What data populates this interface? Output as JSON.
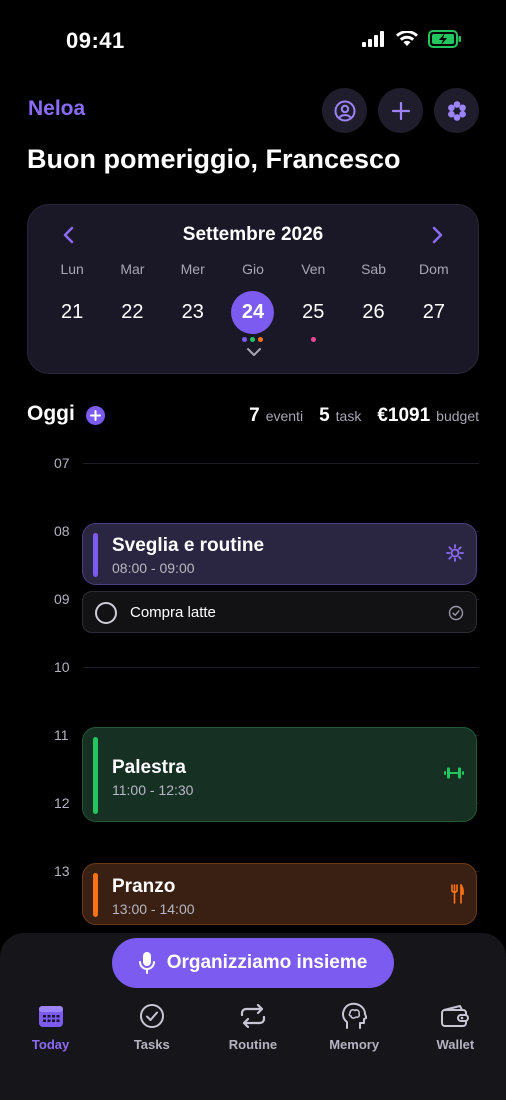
{
  "status": {
    "time": "09:41"
  },
  "header": {
    "brand": "Neloa",
    "greeting": "Buon pomeriggio, Francesco",
    "actions": [
      "profile-icon",
      "plus-icon",
      "apps-icon"
    ]
  },
  "calendar": {
    "month": "Settembre 2026",
    "days": [
      {
        "name": "Lun",
        "num": "21"
      },
      {
        "name": "Mar",
        "num": "22"
      },
      {
        "name": "Mer",
        "num": "23"
      },
      {
        "name": "Gio",
        "num": "24",
        "selected": true
      },
      {
        "name": "Ven",
        "num": "25"
      },
      {
        "name": "Sab",
        "num": "26"
      },
      {
        "name": "Dom",
        "num": "27"
      }
    ],
    "dot_colors": {
      "gio": [
        "#7c5cf0",
        "#22c55e",
        "#f97316"
      ],
      "ven": [
        "#ec4899"
      ]
    }
  },
  "today": {
    "title": "Oggi",
    "events_count": "7",
    "events_label": "eventi",
    "tasks_count": "5",
    "tasks_label": "task",
    "budget_value": "€1091",
    "budget_label": "budget"
  },
  "timeline": {
    "hours": [
      "07",
      "08",
      "09",
      "10",
      "11",
      "12",
      "13"
    ],
    "events": [
      {
        "title": "Sveglia e routine",
        "time": "08:00 - 09:00",
        "color": "#7c5cf0",
        "icon": "sun-icon"
      },
      {
        "title": "Palestra",
        "time": "11:00 - 12:30",
        "color": "#22c55e",
        "icon": "dumbbell-icon"
      },
      {
        "title": "Pranzo",
        "time": "13:00 - 14:00",
        "color": "#f97316",
        "icon": "fork-knife-icon"
      }
    ],
    "task": {
      "title": "Compra latte"
    }
  },
  "assistant": {
    "cta": "Organizziamo insieme"
  },
  "nav": {
    "items": [
      {
        "label": "Today",
        "icon": "calendar-icon",
        "active": true
      },
      {
        "label": "Tasks",
        "icon": "check-circle-icon"
      },
      {
        "label": "Routine",
        "icon": "repeat-icon"
      },
      {
        "label": "Memory",
        "icon": "brain-icon"
      },
      {
        "label": "Wallet",
        "icon": "wallet-icon"
      }
    ]
  },
  "colors": {
    "accent": "#7c5cf0",
    "brand": "#8b6cf6",
    "green": "#22c55e",
    "orange": "#f97316",
    "pink": "#ec4899"
  }
}
